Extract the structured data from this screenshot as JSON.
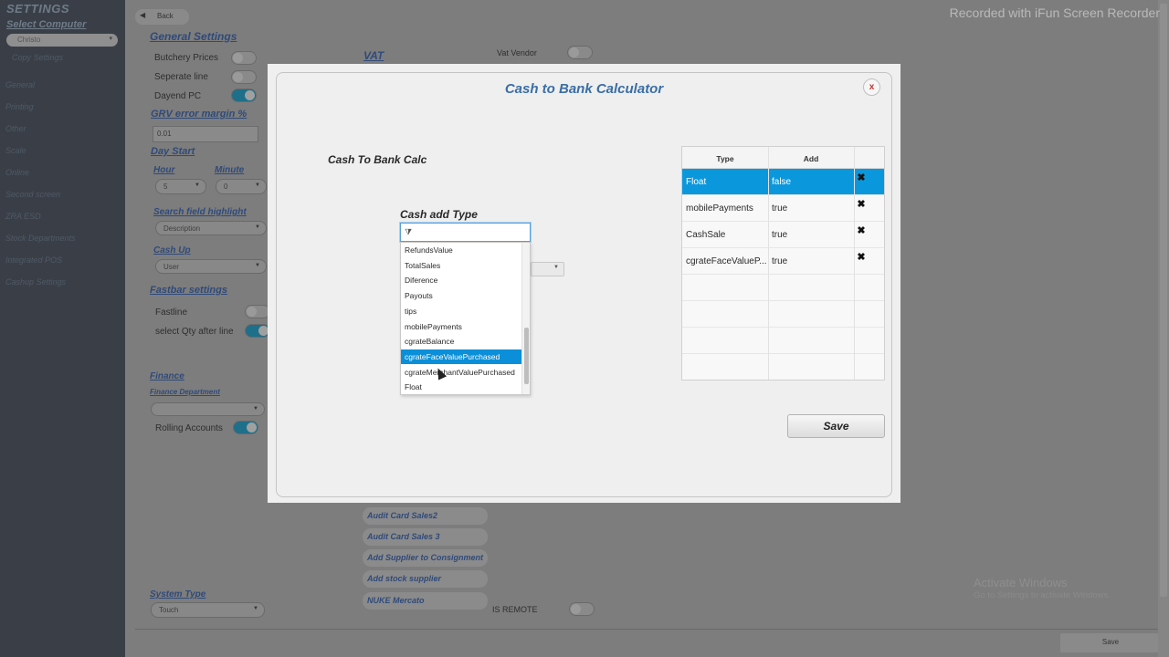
{
  "watermark": "Recorded with iFun Screen Recorder",
  "activation": {
    "title": "Activate Windows",
    "subtitle": "Go to Settings to activate Windows."
  },
  "sidebar": {
    "title": "SETTINGS",
    "subtitle": "Select Computer",
    "computer_value": "Christo",
    "items": [
      "Copy Settings",
      "General",
      "Printing",
      "Other",
      "Scale",
      "Online",
      "Second screen",
      "ZRA ESD",
      "Stock Departments",
      "Integrated POS",
      "Cashup Settings"
    ]
  },
  "page": {
    "back_label": "Back",
    "general_settings": "General Settings",
    "butchery_prices": "Butchery Prices",
    "seperate_line": "Seperate line",
    "dayend_pc": "Dayend PC",
    "grv_error_margin": "GRV error margin %",
    "grv_value": "0.01",
    "day_start": "Day Start",
    "hour_label": "Hour",
    "minute_label": "Minute",
    "hour_value": "5",
    "minute_value": "0",
    "search_field_highlight": "Search field highlight",
    "search_value": "Description",
    "cash_up": "Cash Up",
    "cash_up_value": "User",
    "fastbar_settings": "Fastbar settings",
    "fastline": "Fastline",
    "select_qty": "select Qty after line",
    "finance": "Finance",
    "finance_department": "Finance Department",
    "rolling_accounts": "Rolling Accounts",
    "system_type": "System Type",
    "system_type_value": "Touch",
    "vat": "VAT",
    "vat_vendor": "Vat Vendor",
    "is_remote": "IS REMOTE",
    "buttons": [
      "Audit Card Sales2",
      "Audit Card Sales 3",
      "Add Supplier to Consignment",
      "Add stock supplier",
      "NUKE Mercato"
    ],
    "save_label": "Save"
  },
  "dialog": {
    "title": "Cash to Bank Calculator",
    "close_label": "x",
    "section_title": "Cash To Bank Calc",
    "field_label": "Cash add Type",
    "filter_icon": "funnel-icon",
    "dropdown_items": [
      "RefundsValue",
      "TotalSales",
      "Diference",
      "Payouts",
      "tips",
      "mobilePayments",
      "cgrateBalance",
      "cgrateFaceValuePurchased",
      "cgrateMerchantValuePurchased",
      "Float"
    ],
    "dropdown_selected": "cgrateFaceValuePurchased",
    "table": {
      "columns": [
        "Type",
        "Add",
        ""
      ],
      "rows": [
        {
          "type": "Float",
          "add": "false",
          "selected": true
        },
        {
          "type": "mobilePayments",
          "add": "true",
          "selected": false
        },
        {
          "type": "CashSale",
          "add": "true",
          "selected": false
        },
        {
          "type": "cgrateFaceValueP...",
          "add": "true",
          "selected": false
        }
      ],
      "delete_symbol": "✖"
    },
    "save_label": "Save"
  }
}
